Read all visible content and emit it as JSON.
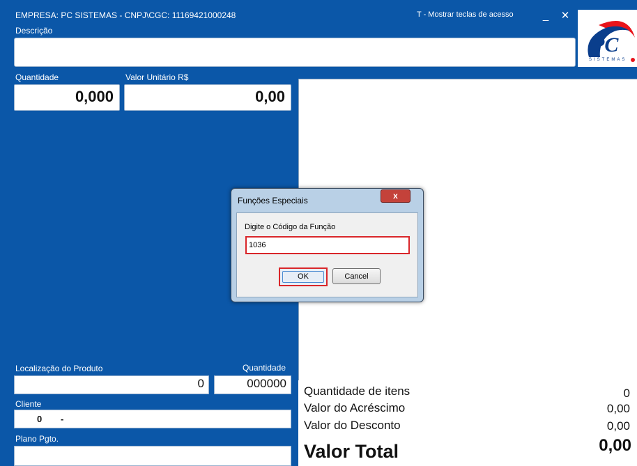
{
  "header": {
    "title": "EMPRESA: PC SISTEMAS  -  CNPJ\\CGC: 11169421000248",
    "shortcut_hint": "T - Mostrar teclas de acesso",
    "minimize_glyph": "_",
    "close_glyph": "✕",
    "logo_icon": "pc-sistemas-logo"
  },
  "fields": {
    "description_label": "Descrição",
    "description_value": "",
    "quantity_label": "Quantidade",
    "quantity_value": "0,000",
    "unit_price_label": "Valor Unitário R$",
    "unit_price_value": "0,00",
    "location_label": "Localização do Produto",
    "location_value": "0",
    "location_qty_label": "Quantidade",
    "location_qty_value": "000000",
    "client_label": "Cliente",
    "client_code": "0",
    "client_sep": "-",
    "payment_plan_label": "Plano Pgto.",
    "payment_plan_value": ""
  },
  "summary": {
    "items_label": "Quantidade de itens",
    "items_value": "0",
    "surcharge_label": "Valor do Acréscimo",
    "surcharge_value": "0,00",
    "discount_label": "Valor do Desconto",
    "discount_value": "0,00",
    "total_label": "Valor Total",
    "total_value": "0,00"
  },
  "dialog": {
    "title": "Funções Especiais",
    "close_glyph": "x",
    "prompt": "Digite o Código da Função",
    "input_value": "1036",
    "ok_label": "OK",
    "cancel_label": "Cancel"
  },
  "colors": {
    "background_blue": "#0b57a8",
    "highlight_red": "#d9262a",
    "close_button_red": "#c4423a"
  }
}
